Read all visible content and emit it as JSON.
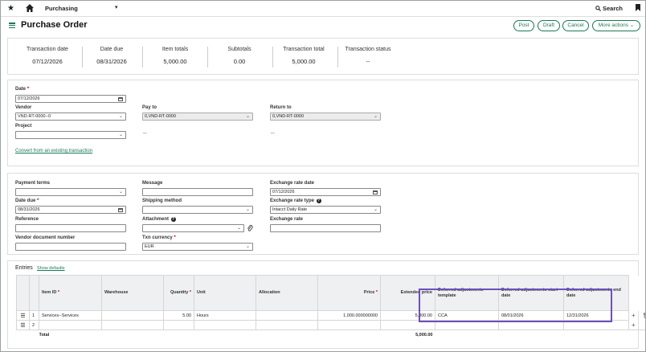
{
  "topbar": {
    "module": "Purchasing",
    "search": "Search"
  },
  "titlebar": {
    "title": "Purchase Order",
    "actions": {
      "post": "Post",
      "draft": "Draft",
      "cancel": "Cancel",
      "more": "More actions"
    }
  },
  "summary": [
    {
      "label": "Transaction date",
      "value": "07/12/2026"
    },
    {
      "label": "Date due",
      "value": "08/31/2026"
    },
    {
      "label": "Item totals",
      "value": "5,000.00"
    },
    {
      "label": "Subtotals",
      "value": "0.00"
    },
    {
      "label": "Transaction total",
      "value": "5,000.00"
    },
    {
      "label": "Transaction status",
      "value": "--"
    }
  ],
  "header_fields": {
    "date_label": "Date",
    "date_value": "07/12/2026",
    "vendor_label": "Vendor",
    "vendor_value": "VND-RT-0000--0",
    "pay_to_label": "Pay to",
    "pay_to_value": "0,VND-RT-0000",
    "return_to_label": "Return to",
    "return_to_value": "0,VND-RT-0000",
    "project_label": "Project",
    "project_value": "",
    "pay_to_dash": "--",
    "return_to_dash": "--",
    "convert_link": "Convert from an existing transaction"
  },
  "terms_fields": {
    "payment_term_label": "Payment terms",
    "payment_term_value": "",
    "message_label": "Message",
    "message_value": "",
    "exchange_date_label": "Exchange rate date",
    "exchange_date_value": "07/12/2026",
    "date_due_label": "Date due",
    "date_due_value": "08/31/2026",
    "shipping_label": "Shipping method",
    "shipping_value": "",
    "rate_type_label": "Exchange rate type",
    "rate_type_value": "Intacct Daily Rate",
    "reference_label": "Reference",
    "reference_value": "",
    "attachment_label": "Attachment",
    "attachment_value": "",
    "exchange_rate_label": "Exchange rate",
    "exchange_rate_value": "",
    "vendor_doc_label": "Vendor document number",
    "vendor_doc_value": "",
    "currency_label": "Txn currency",
    "currency_value": "EUR"
  },
  "entries": {
    "title": "Entries",
    "show_defaults": "Show defaults",
    "columns": [
      "Item ID",
      "Warehouse",
      "Quantity",
      "Unit",
      "Allocation",
      "Price",
      "Extended price",
      "Deferred adjustments template",
      "Deferred adjustments start date",
      "Deferred adjustments end date"
    ],
    "rows": [
      {
        "num": "1",
        "item": "Services--Services",
        "warehouse": "",
        "quantity": "5.00",
        "unit": "Hours",
        "allocation": "",
        "price": "1,000.000000000",
        "extended": "5,000.00",
        "template": "CCA",
        "start": "08/01/2026",
        "end": "12/31/2026"
      },
      {
        "num": "2",
        "item": "",
        "warehouse": "",
        "quantity": "",
        "unit": "",
        "allocation": "",
        "price": "",
        "extended": "",
        "template": "",
        "start": "",
        "end": ""
      }
    ],
    "total_label": "Total",
    "total_value": "5,000.00"
  }
}
